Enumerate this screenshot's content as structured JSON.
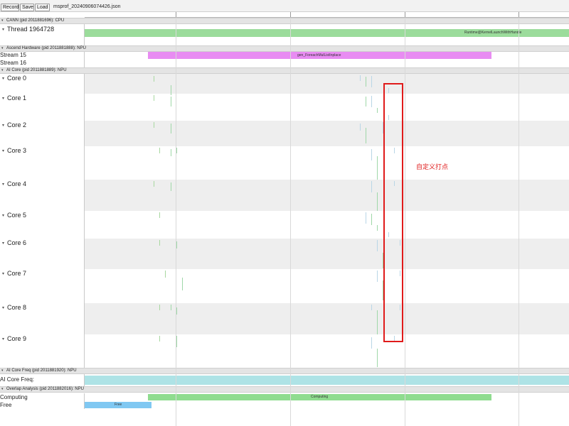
{
  "toolbar": {
    "buttons": [
      {
        "label": "Record"
      },
      {
        "label": "Save"
      },
      {
        "label": "Load"
      }
    ],
    "file_name": "msprof_20240906074426.json"
  },
  "ruler": {
    "labels": [
      "",
      "",
      "",
      "",
      ""
    ]
  },
  "sections": [
    {
      "label": "CANN (pid 2011881696): CPU"
    },
    {
      "label": "Ascend Hardware (pid 2011881888): NPU"
    },
    {
      "label": "AI Core (pid 2011881889): NPU"
    },
    {
      "label": "AI Core Freq (pid 2011881920): NPU"
    },
    {
      "label": "Overlap Analysis (pid 2011882016): NPU"
    }
  ],
  "tracks": {
    "thread": {
      "label": "Thread 1964728"
    },
    "stream15": {
      "label": "Stream 15"
    },
    "stream16": {
      "label": "Stream 16"
    },
    "cores": [
      {
        "label": "Core 0"
      },
      {
        "label": "Core 1"
      },
      {
        "label": "Core 2"
      },
      {
        "label": "Core 3"
      },
      {
        "label": "Core 4"
      },
      {
        "label": "Core 5"
      },
      {
        "label": "Core 6"
      },
      {
        "label": "Core 7"
      },
      {
        "label": "Core 8"
      },
      {
        "label": "Core 9"
      }
    ],
    "freq": {
      "label": "AI Core Freq:"
    },
    "computing": {
      "label": "Computing"
    },
    "free": {
      "label": "Free"
    }
  },
  "slices": {
    "runtime": {
      "text": "Runtime@KernelLaunchWithHandle",
      "color": "#9bdc9b"
    },
    "foreach": {
      "text": "gen_ForeachMulListInplace",
      "color": "#e88cf2"
    },
    "freq_bar": {
      "text": "",
      "color": "#aee3e6"
    },
    "computing": {
      "text": "Computing",
      "color": "#8fdc8f"
    },
    "free": {
      "text": "Free",
      "color": "#80c8f2"
    }
  },
  "annotation": {
    "text": "自定义打点",
    "color": "#e01b1b"
  }
}
